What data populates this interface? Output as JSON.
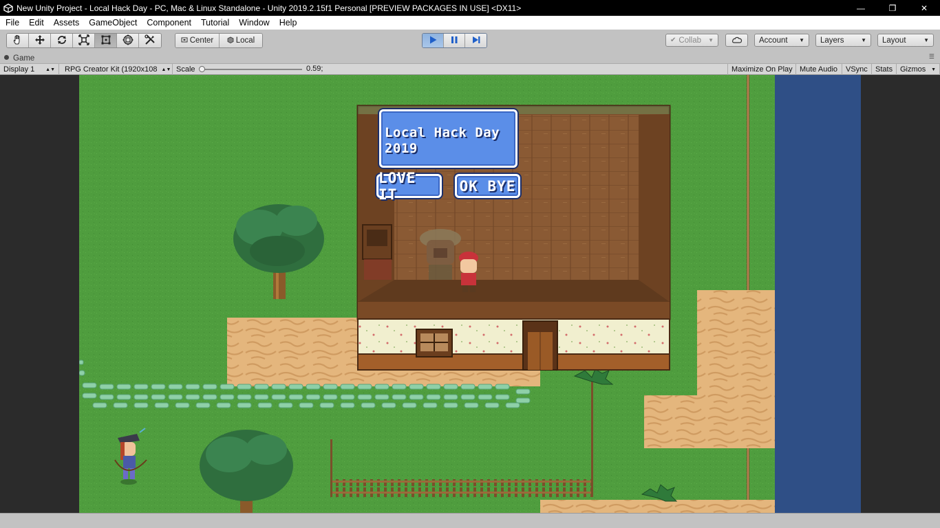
{
  "window": {
    "title": "New Unity Project - Local Hack Day - PC, Mac & Linux Standalone - Unity 2019.2.15f1 Personal [PREVIEW PACKAGES IN USE] <DX11>",
    "minimize_glyph": "—",
    "maximize_glyph": "❐",
    "close_glyph": "✕"
  },
  "menu": [
    "File",
    "Edit",
    "Assets",
    "GameObject",
    "Component",
    "Tutorial",
    "Window",
    "Help"
  ],
  "toolbar": {
    "tools": [
      "hand-tool-icon",
      "move-tool-icon",
      "rotate-tool-icon",
      "scale-tool-icon",
      "rect-tool-icon",
      "transform-tool-icon",
      "custom-tool-icon"
    ],
    "active_tool_index": 4,
    "pivot_mode": "Center",
    "pivot_rotation": "Local",
    "collab": "Collab",
    "account": "Account",
    "layers": "Layers",
    "layout": "Layout"
  },
  "game_tab": {
    "label": "Game"
  },
  "game_bar": {
    "display": "Display 1",
    "resolution": "RPG Creator Kit (1920x108",
    "scale_label": "Scale",
    "scale_value": "0.59;",
    "maximize_on_play": "Maximize On Play",
    "mute_audio": "Mute Audio",
    "vsync": "VSync",
    "stats": "Stats",
    "gizmos": "Gizmos"
  },
  "game": {
    "dialog_text": "Local Hack Day\n2019",
    "choice_1": "LOVE IT",
    "choice_2": "OK BYE",
    "colors": {
      "grass": "#4f9d3e",
      "sand": "#e2b37a",
      "water": "#2f4f86",
      "wood": "#8a5a34",
      "dialog": "#5b8ee8"
    }
  }
}
